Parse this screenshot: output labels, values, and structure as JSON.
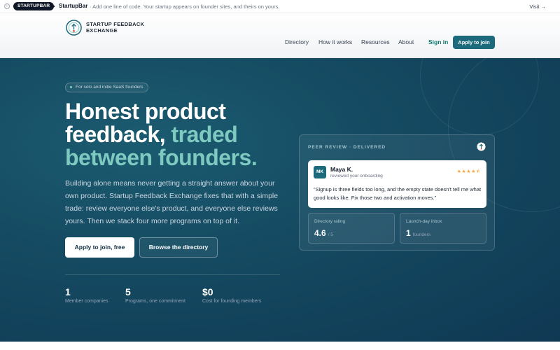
{
  "topbar": {
    "pill": "STARTUPBAR",
    "brand": "StartupBar",
    "tagline": "· Add one line of code. Your startup appears on founder sites, and theirs on yours.",
    "visit": "Visit →"
  },
  "header": {
    "logo_line1": "STARTUP FEEDBACK",
    "logo_line2": "EXCHANGE",
    "nav": [
      "Directory",
      "How it works",
      "Resources",
      "About"
    ],
    "signin": "Sign in",
    "apply": "Apply to join"
  },
  "hero": {
    "badge": "For solo and indie SaaS founders",
    "title_line1": "Honest product",
    "title_line2a": "feedback,",
    "title_line2b": "traded",
    "title_line3": "between founders.",
    "lead": "Building alone means never getting a straight answer about your own product. Startup Feedback Exchange fixes that with a simple trade: review everyone else's product, and everyone else reviews yours. Then we stack four more programs on top of it.",
    "cta_primary": "Apply to join, free",
    "cta_secondary": "Browse the directory",
    "stats": [
      {
        "value": "1",
        "label": "Member companies"
      },
      {
        "value": "5",
        "label": "Programs, one commitment"
      },
      {
        "value": "$0",
        "label": "Cost for founding members"
      }
    ]
  },
  "card": {
    "title": "PEER REVIEW · DELIVERED",
    "review": {
      "initials": "MK",
      "name": "Maya K.",
      "subtitle": "reviewed your onboarding",
      "stars": "★★★★⯪",
      "quote": "“Signup is three fields too long, and the empty state doesn't tell me what good looks like. Fix those two and activation moves.”"
    },
    "metrics": [
      {
        "label": "Directory rating",
        "value": "4.6",
        "sub": "/ 5"
      },
      {
        "label": "Launch-day inbox",
        "value": "1",
        "sub": "founders"
      }
    ]
  },
  "colors": {
    "brand": "#1d6a7d",
    "accent": "#7ec9c0",
    "hero_bg": "#154b62",
    "star": "#f4a53b"
  }
}
